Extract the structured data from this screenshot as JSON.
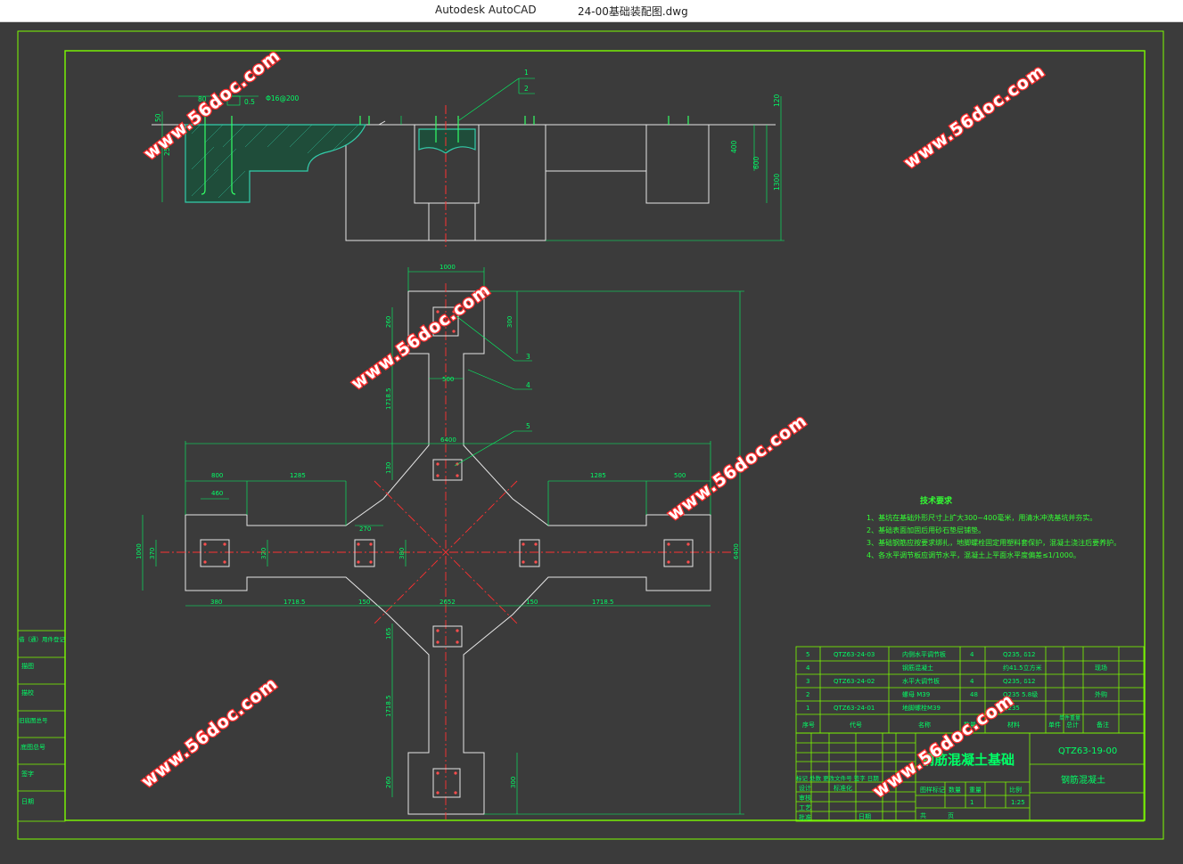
{
  "window": {
    "app_name": "Autodesk AutoCAD",
    "document_name": "24-00基础装配图.dwg"
  },
  "colors": {
    "background": "#3b3b3b",
    "frame": "#7cfc00",
    "outline": "#e6e6e6",
    "dimension": "#00ff66",
    "centerline": "#ff3030",
    "concrete": "#33ccaa",
    "watermark_fill": "#ffffff",
    "watermark_stroke": "#ff2d2d"
  },
  "watermark_text": "www.56doc.com",
  "section_view": {
    "leaders": [
      "1",
      "2"
    ],
    "dims": {
      "d80": "80",
      "d05": "0.5",
      "rebar": "Φ16@200",
      "d400": "400",
      "d600": "600",
      "d1300": "1300",
      "d250": "250",
      "d50": "50",
      "d120": "120"
    }
  },
  "plan_view": {
    "leaders": [
      "3",
      "4",
      "5"
    ],
    "dims": {
      "d1000": "1000",
      "d260a": "260",
      "d300a": "300",
      "d500": "500",
      "d1718_top": "1718.5",
      "d6400": "6400",
      "d130a": "130",
      "d800l": "800",
      "d460": "460",
      "d1285l": "1285",
      "d1285r": "1285",
      "d500r": "500",
      "d1000v": "1000",
      "d370": "370",
      "d270": "270",
      "d320": "320",
      "d6400v": "6400",
      "d380": "380",
      "d1718_l": "1718.5",
      "d150l": "150",
      "d2652": "2652",
      "d150r": "150",
      "d1718_r": "1718.5",
      "d380r": "380",
      "d165": "165",
      "d1718_bot": "1718.5",
      "d260b": "260",
      "d300b": "300"
    }
  },
  "tech_requirements": {
    "title": "技术要求",
    "items": [
      "1、基坑在基础外形尺寸上扩大300~400毫米，用清水冲洗基坑并夯实。",
      "2、基础表面加固后用砂石垫层铺垫。",
      "3、基础钢筋应按要求绑扎，地脚螺栓固定用塑料套保护，混凝土浇注后要养护。",
      "4、各水平调节板应调节水平，混凝土上平面水平度偏差≤1/1000。"
    ]
  },
  "bom": {
    "rows": [
      {
        "no": "5",
        "code": "QTZ63-24-03",
        "name": "内侧水平调节板",
        "qty": "4",
        "material": "Q235, δ12",
        "note": ""
      },
      {
        "no": "4",
        "code": "",
        "name": "钢筋混凝土",
        "qty": "",
        "material": "约41.5立方米",
        "note": "现场"
      },
      {
        "no": "3",
        "code": "QTZ63-24-02",
        "name": "水平大调节板",
        "qty": "4",
        "material": "Q235, δ12",
        "note": ""
      },
      {
        "no": "2",
        "code": "",
        "name": "螺母 M39",
        "qty": "48",
        "material": "Q235 5.8级",
        "note": "外购"
      },
      {
        "no": "1",
        "code": "QTZ63-24-01",
        "name": "地脚螺栓M39",
        "qty": "",
        "material": "Q235",
        "note": ""
      }
    ],
    "headers": {
      "no": "序号",
      "code": "代号",
      "name": "名称",
      "qty": "数量",
      "material": "材料",
      "weight1": "单件",
      "weight2": "总计",
      "unit_weight": "单件重量",
      "note": "备注"
    }
  },
  "title_block": {
    "drawing_title": "钢筋混凝土基础",
    "drawing_no": "QTZ63-19-00",
    "material": "钢筋混凝土",
    "labels": {
      "stage": "图样标记",
      "qty": "数量",
      "weight": "重量",
      "scale": "比例",
      "sheet": "共",
      "page": "页",
      "design": "设计",
      "check": "审核",
      "craft": "工艺",
      "approve": "批准",
      "date": "日期",
      "std": "标准化"
    },
    "values": {
      "qty": "1",
      "scale": "1:25"
    },
    "revision_header": "标记 处数 更改文件号 签字 日期"
  },
  "side_block": {
    "items": [
      "借（通）用件登记",
      "描图",
      "描校",
      "旧底图总号",
      "底图总号",
      "签字",
      "日期"
    ]
  }
}
